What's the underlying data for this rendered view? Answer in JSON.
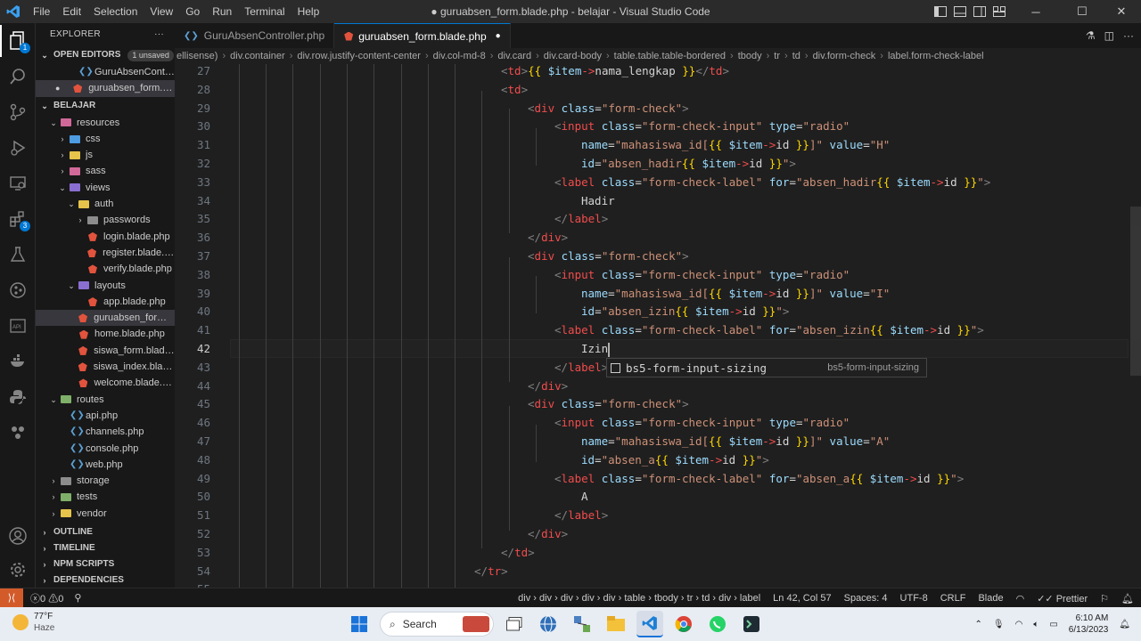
{
  "window": {
    "title": "● guruabsen_form.blade.php - belajar - Visual Studio Code",
    "menu": [
      "File",
      "Edit",
      "Selection",
      "View",
      "Go",
      "Run",
      "Terminal",
      "Help"
    ]
  },
  "explorer": {
    "header": "EXPLORER",
    "open_editors": "OPEN EDITORS",
    "unsaved_badge": "1 unsaved",
    "open_files": [
      "GuruAbsenControll...",
      "guruabsen_form.bl..."
    ],
    "project": "BELAJAR",
    "tree": [
      {
        "label": "resources",
        "depth": 0,
        "type": "folder",
        "open": true,
        "color": "pink"
      },
      {
        "label": "css",
        "depth": 1,
        "type": "folder",
        "open": false,
        "color": "blue"
      },
      {
        "label": "js",
        "depth": 1,
        "type": "folder",
        "open": false,
        "color": "yellow"
      },
      {
        "label": "sass",
        "depth": 1,
        "type": "folder",
        "open": false,
        "color": "pink"
      },
      {
        "label": "views",
        "depth": 1,
        "type": "folder",
        "open": true,
        "color": "vio"
      },
      {
        "label": "auth",
        "depth": 2,
        "type": "folder",
        "open": true,
        "color": "yellow"
      },
      {
        "label": "passwords",
        "depth": 3,
        "type": "folder",
        "open": false,
        "color": "grey"
      },
      {
        "label": "login.blade.php",
        "depth": 3,
        "type": "blade"
      },
      {
        "label": "register.blade.php",
        "depth": 3,
        "type": "blade"
      },
      {
        "label": "verify.blade.php",
        "depth": 3,
        "type": "blade"
      },
      {
        "label": "layouts",
        "depth": 2,
        "type": "folder",
        "open": true,
        "color": "vio"
      },
      {
        "label": "app.blade.php",
        "depth": 3,
        "type": "blade"
      },
      {
        "label": "guruabsen_form.b...",
        "depth": 2,
        "type": "blade",
        "selected": true
      },
      {
        "label": "home.blade.php",
        "depth": 2,
        "type": "blade"
      },
      {
        "label": "siswa_form.blade....",
        "depth": 2,
        "type": "blade"
      },
      {
        "label": "siswa_index.blade....",
        "depth": 2,
        "type": "blade"
      },
      {
        "label": "welcome.blade.php",
        "depth": 2,
        "type": "blade"
      },
      {
        "label": "routes",
        "depth": 0,
        "type": "folder",
        "open": true,
        "color": "green"
      },
      {
        "label": "api.php",
        "depth": 1,
        "type": "php"
      },
      {
        "label": "channels.php",
        "depth": 1,
        "type": "php"
      },
      {
        "label": "console.php",
        "depth": 1,
        "type": "php"
      },
      {
        "label": "web.php",
        "depth": 1,
        "type": "php"
      },
      {
        "label": "storage",
        "depth": 0,
        "type": "folder",
        "open": false,
        "color": "grey"
      },
      {
        "label": "tests",
        "depth": 0,
        "type": "folder",
        "open": false,
        "color": "green"
      },
      {
        "label": "vendor",
        "depth": 0,
        "type": "folder",
        "open": false,
        "color": "yellow"
      }
    ],
    "sections": [
      "OUTLINE",
      "TIMELINE",
      "NPM SCRIPTS",
      "DEPENDENCIES"
    ]
  },
  "tabs": [
    {
      "label": "GuruAbsenController.php",
      "active": false
    },
    {
      "label": "guruabsen_form.blade.php",
      "active": true,
      "dirty": true
    }
  ],
  "breadcrumbs": [
    "ellisense)",
    "div.container",
    "div.row.justify-content-center",
    "div.col-md-8",
    "div.card",
    "div.card-body",
    "table.table.table-bordered",
    "tbody",
    "tr",
    "td",
    "div.form-check",
    "label.form-check-label"
  ],
  "editor": {
    "line_numbers": [
      "27",
      "28",
      "29",
      "30",
      "31",
      "32",
      "33",
      "34",
      "35",
      "36",
      "37",
      "38",
      "39",
      "40",
      "41",
      "42",
      "43",
      "44",
      "45",
      "46",
      "47",
      "48",
      "49",
      "50",
      "51",
      "52",
      "53",
      "54",
      "55"
    ],
    "current_line": "42",
    "suggestion": {
      "label": "bs5-form-input-sizing",
      "detail": "bs5-form-input-sizing"
    }
  },
  "statusbar": {
    "errors": "0",
    "warnings": "0",
    "path": "div › div › div › div › div › table › tbody › tr › td › div › label",
    "cursor": "Ln 42, Col 57",
    "spaces": "Spaces: 4",
    "encoding": "UTF-8",
    "eol": "CRLF",
    "language": "Blade",
    "formatter": "Prettier"
  },
  "taskbar": {
    "temp": "77°F",
    "weather": "Haze",
    "search": "Search",
    "time": "6:10 AM",
    "date": "6/13/2023"
  },
  "colors": {
    "accent": "#0078d4",
    "remote": "#d35b2a",
    "editor_bg": "#1f1f1f"
  }
}
